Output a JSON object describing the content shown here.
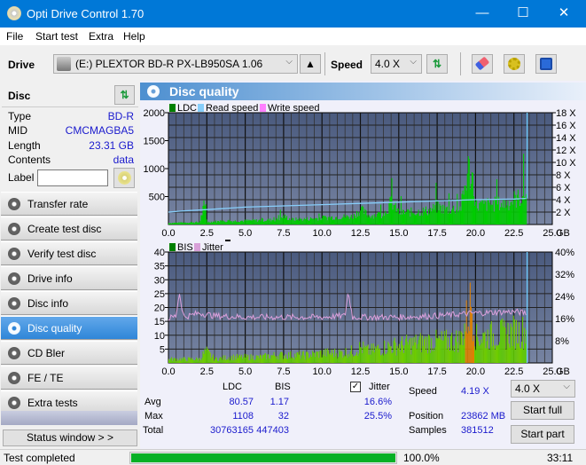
{
  "window": {
    "title": "Opti Drive Control 1.70",
    "minimize": "—",
    "maximize": "☐",
    "close": "✕"
  },
  "menu": [
    "File",
    "Start test",
    "Extra",
    "Help"
  ],
  "toolbar": {
    "drive_label": "Drive",
    "drive_value": "(E:)  PLEXTOR BD-R  PX-LB950SA 1.06",
    "speed_label": "Speed",
    "speed_value": "4.0 X",
    "eject_icon": "▲",
    "chevron": "⌵"
  },
  "disc": {
    "header": "Disc",
    "rows": [
      {
        "key": "Type",
        "value": "BD-R"
      },
      {
        "key": "MID",
        "value": "CMCMAGBA5"
      },
      {
        "key": "Length",
        "value": "23.31 GB"
      },
      {
        "key": "Contents",
        "value": "data"
      }
    ],
    "label_key": "Label",
    "label_value": ""
  },
  "nav": {
    "items": [
      {
        "label": "Transfer rate",
        "active": false
      },
      {
        "label": "Create test disc",
        "active": false
      },
      {
        "label": "Verify test disc",
        "active": false
      },
      {
        "label": "Drive info",
        "active": false
      },
      {
        "label": "Disc info",
        "active": false
      },
      {
        "label": "Disc quality",
        "active": true
      },
      {
        "label": "CD Bler",
        "active": false
      },
      {
        "label": "FE / TE",
        "active": false
      },
      {
        "label": "Extra tests",
        "active": false
      }
    ],
    "status_window": "Status window > >"
  },
  "panel": {
    "title": "Disc quality"
  },
  "chart_data": [
    {
      "type": "area",
      "title": "LDC / Read speed",
      "legend": [
        {
          "name": "LDC",
          "color": "#008000"
        },
        {
          "name": "Read speed",
          "color": "#87cefa"
        },
        {
          "name": "Write speed",
          "color": "#ff80ff"
        }
      ],
      "legend_placement": "top-left",
      "x_unit": "GB",
      "xlim": [
        0,
        25
      ],
      "x_ticks": [
        "0.0",
        "2.5",
        "5.0",
        "7.5",
        "10.0",
        "12.5",
        "15.0",
        "17.5",
        "20.0",
        "22.5",
        "25.0"
      ],
      "ylim_left": [
        0,
        2000
      ],
      "y_ticks_left": [
        "500",
        "1000",
        "1500",
        "2000"
      ],
      "ylim_right": [
        0,
        18
      ],
      "y_ticks_right": [
        "2 X",
        "4 X",
        "6 X",
        "8 X",
        "10 X",
        "12 X",
        "14 X",
        "16 X",
        "18 X"
      ],
      "grid": true,
      "series": [
        {
          "name": "LDC",
          "x": [
            0,
            1,
            2,
            2.3,
            2.5,
            3,
            4,
            5,
            6,
            7,
            7.5,
            8,
            9,
            10,
            11,
            12,
            12.5,
            13,
            14,
            14.5,
            15,
            16,
            17,
            17.5,
            18,
            19,
            19.5,
            19.8,
            20,
            21,
            22,
            22.5,
            23,
            23.3
          ],
          "values": [
            30,
            40,
            45,
            380,
            50,
            60,
            70,
            75,
            85,
            95,
            160,
            100,
            110,
            130,
            150,
            160,
            300,
            180,
            200,
            450,
            230,
            250,
            280,
            350,
            300,
            320,
            1100,
            900,
            380,
            400,
            420,
            500,
            550,
            620
          ]
        },
        {
          "name": "Read speed",
          "x": [
            0,
            1,
            2.5,
            5,
            7.5,
            10,
            12.5,
            15,
            17.5,
            20,
            22.5,
            23.3
          ],
          "values": [
            2.0,
            2.2,
            2.4,
            2.8,
            3.0,
            3.2,
            3.4,
            3.6,
            3.8,
            4.0,
            4.1,
            4.2
          ]
        }
      ]
    },
    {
      "type": "area",
      "title": "BIS / Jitter",
      "legend": [
        {
          "name": "BIS",
          "color": "#008000"
        },
        {
          "name": "Jitter",
          "color": "#d8a0d8"
        }
      ],
      "legend_placement": "top-left",
      "x_unit": "GB",
      "xlim": [
        0,
        25
      ],
      "x_ticks": [
        "0.0",
        "2.5",
        "5.0",
        "7.5",
        "10.0",
        "12.5",
        "15.0",
        "17.5",
        "20.0",
        "22.5",
        "25.0"
      ],
      "ylim_left": [
        0,
        40
      ],
      "y_ticks_left": [
        "5",
        "10",
        "15",
        "20",
        "25",
        "30",
        "35",
        "40"
      ],
      "ylim_right": [
        0,
        40
      ],
      "y_ticks_right": [
        "8%",
        "16%",
        "24%",
        "32%",
        "40%"
      ],
      "grid": true,
      "series": [
        {
          "name": "BIS",
          "x": [
            0,
            1,
            2,
            2.4,
            3,
            4,
            5,
            6,
            7,
            8,
            9,
            10,
            11,
            12,
            12.5,
            13,
            14,
            15,
            16,
            17,
            18,
            19,
            19.5,
            19.7,
            20,
            21,
            22,
            22.5,
            23,
            23.3
          ],
          "values": [
            2,
            2,
            2,
            6,
            2,
            3,
            3,
            3,
            4,
            4,
            4,
            5,
            5,
            6,
            8,
            6,
            8,
            9,
            10,
            11,
            11,
            12,
            25,
            32,
            13,
            14,
            15,
            16,
            16,
            17
          ]
        },
        {
          "name": "Jitter",
          "x": [
            0,
            0.5,
            0.7,
            1,
            2,
            3,
            5,
            7.5,
            10,
            11.5,
            11.7,
            12,
            15,
            17.5,
            20,
            22.5,
            23.3
          ],
          "values": [
            16,
            17,
            25.5,
            16.5,
            18,
            17,
            16.5,
            16.5,
            16.5,
            17,
            25.5,
            16.5,
            16.5,
            17,
            18,
            18.5,
            18
          ]
        }
      ]
    }
  ],
  "stats": {
    "col_ldc": "LDC",
    "col_bis": "BIS",
    "jitter_label": "Jitter",
    "jitter_checked": true,
    "rows": [
      {
        "label": "Avg",
        "ldc": "80.57",
        "bis": "1.17",
        "jitter": "16.6%"
      },
      {
        "label": "Max",
        "ldc": "1108",
        "bis": "32",
        "jitter": "25.5%"
      },
      {
        "label": "Total",
        "ldc": "30763165",
        "bis": "447403",
        "jitter": ""
      }
    ],
    "speed_label": "Speed",
    "speed_value": "4.19 X",
    "position_label": "Position",
    "position_value": "23862 MB",
    "samples_label": "Samples",
    "samples_value": "381512",
    "speed_select": "4.0 X",
    "start_full": "Start full",
    "start_part": "Start part"
  },
  "statusbar": {
    "text": "Test completed",
    "progress_percent": 100,
    "progress_label": "100.0%",
    "elapsed": "33:11"
  }
}
